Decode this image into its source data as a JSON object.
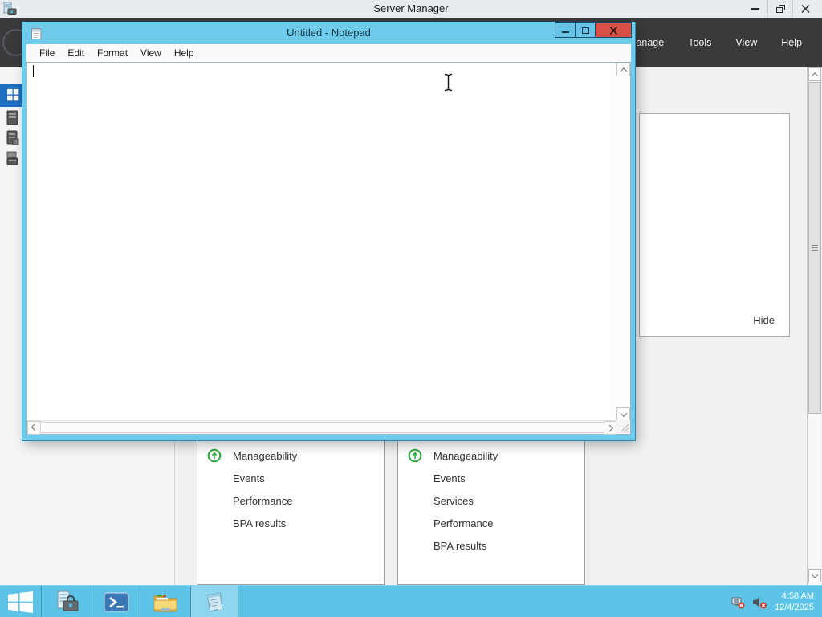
{
  "server_manager": {
    "title": "Server Manager",
    "nav_menu": {
      "manage": "Manage",
      "tools": "Tools",
      "view": "View",
      "help": "Help"
    },
    "hide_label": "Hide",
    "tiles": [
      {
        "rows": [
          "Manageability",
          "Events",
          "Performance",
          "BPA results"
        ]
      },
      {
        "rows": [
          "Manageability",
          "Events",
          "Services",
          "Performance",
          "BPA results"
        ]
      }
    ]
  },
  "notepad": {
    "title": "Untitled - Notepad",
    "menu": [
      "File",
      "Edit",
      "Format",
      "View",
      "Help"
    ],
    "text_content": ""
  },
  "taskbar": {
    "time": "4:58 AM",
    "date": "12/4/2025"
  },
  "colors": {
    "taskbar_cyan": "#5dc4e8",
    "notepad_chrome_cyan": "#6fcbec",
    "close_button_red": "#d95046",
    "selection_blue": "#1d6fbf",
    "status_green": "#2ca83c",
    "header_dark": "#3a3a3c"
  }
}
